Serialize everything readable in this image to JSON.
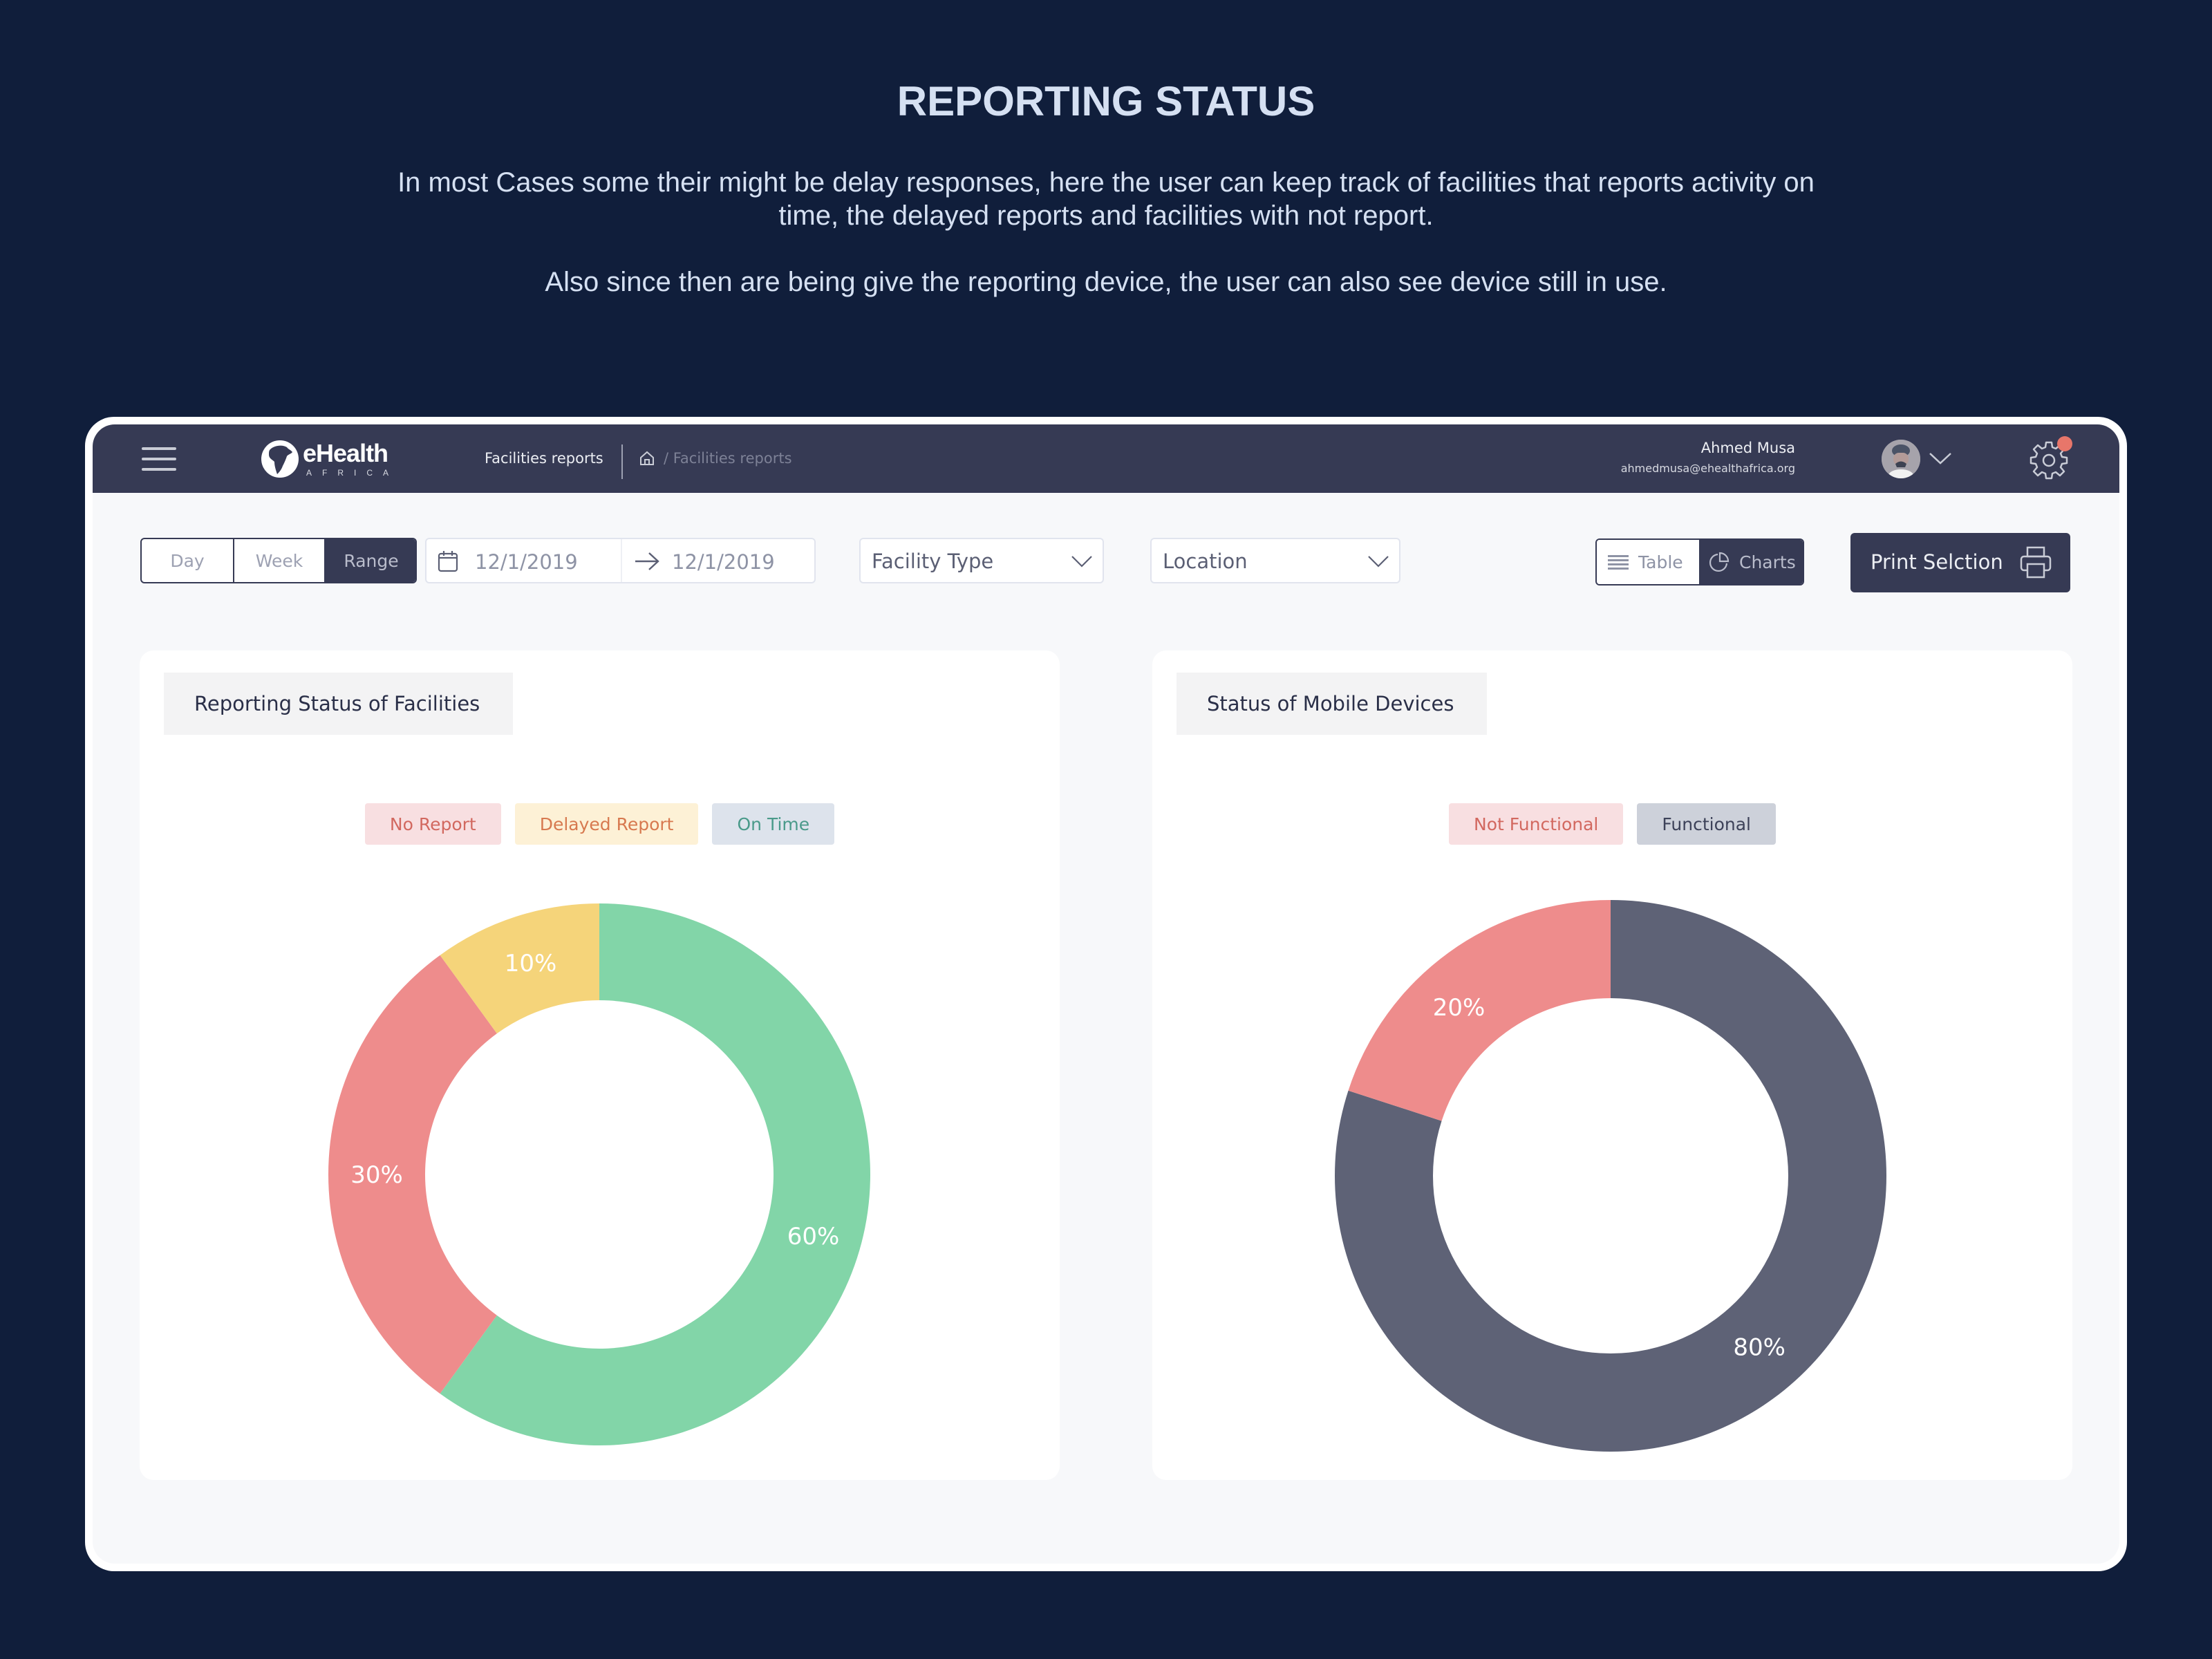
{
  "hero": {
    "title": "REPORTING STATUS",
    "paragraph_1_line_1": "In most Cases some their might be delay responses, here the user can keep track of facilities that reports activity on",
    "paragraph_1_line_2": "time, the delayed reports and facilities with not report.",
    "paragraph_2": "Also since then are being give the reporting device, the user can also see device still in use."
  },
  "header": {
    "logo_word": "eHealth",
    "logo_sub": "AFRICA",
    "page_label": "Facilities reports",
    "breadcrumb": "/ Facilities reports",
    "user_name": "Ahmed Musa",
    "user_email": "ahmedmusa@ehealthafrica.org",
    "has_notification": true
  },
  "filters": {
    "period_options": [
      "Day",
      "Week",
      "Range"
    ],
    "period_selected": "Range",
    "date_start": "12/1/2019",
    "date_end": "12/1/2019",
    "facility_type": "Facility Type",
    "location": "Location",
    "view_options": [
      "Table",
      "Charts"
    ],
    "view_selected": "Charts",
    "print_label": "Print Selction"
  },
  "colors": {
    "background": "#101e3b",
    "header": "#363a54",
    "no_report": "#ee8c8c",
    "delayed": "#f5d47a",
    "on_time": "#82d5a8",
    "not_functional": "#ee8c8c",
    "functional": "#5e6276"
  },
  "chart_data": [
    {
      "type": "pie",
      "title": "Reporting Status of Facilities",
      "donut": true,
      "legend": [
        "No Report",
        "Delayed Report",
        "On Time"
      ],
      "legend_placement": "top-center",
      "slices": [
        {
          "label": "On Time",
          "value": 60,
          "display": "60%",
          "color": "#82d5a8",
          "chip_bg": "#dde3ec",
          "chip_fg": "#4a9a8a"
        },
        {
          "label": "No Report",
          "value": 30,
          "display": "30%",
          "color": "#ee8c8c",
          "chip_bg": "#f8dfe1",
          "chip_fg": "#d2685f"
        },
        {
          "label": "Delayed Report",
          "value": 10,
          "display": "10%",
          "color": "#f5d47a",
          "chip_bg": "#fdf1d6",
          "chip_fg": "#d7794f"
        }
      ],
      "legend_order": [
        1,
        2,
        0
      ]
    },
    {
      "type": "pie",
      "title": "Status of Mobile Devices",
      "donut": true,
      "legend": [
        "Not Functional",
        "Functional"
      ],
      "legend_placement": "top-center",
      "slices": [
        {
          "label": "Functional",
          "value": 80,
          "display": "80%",
          "color": "#5e6276",
          "chip_bg": "#cdd1da",
          "chip_fg": "#3d4259"
        },
        {
          "label": "Not Functional",
          "value": 20,
          "display": "20%",
          "color": "#ee8c8c",
          "chip_bg": "#f8dfe1",
          "chip_fg": "#d2685f"
        }
      ],
      "legend_order": [
        1,
        0
      ]
    }
  ]
}
